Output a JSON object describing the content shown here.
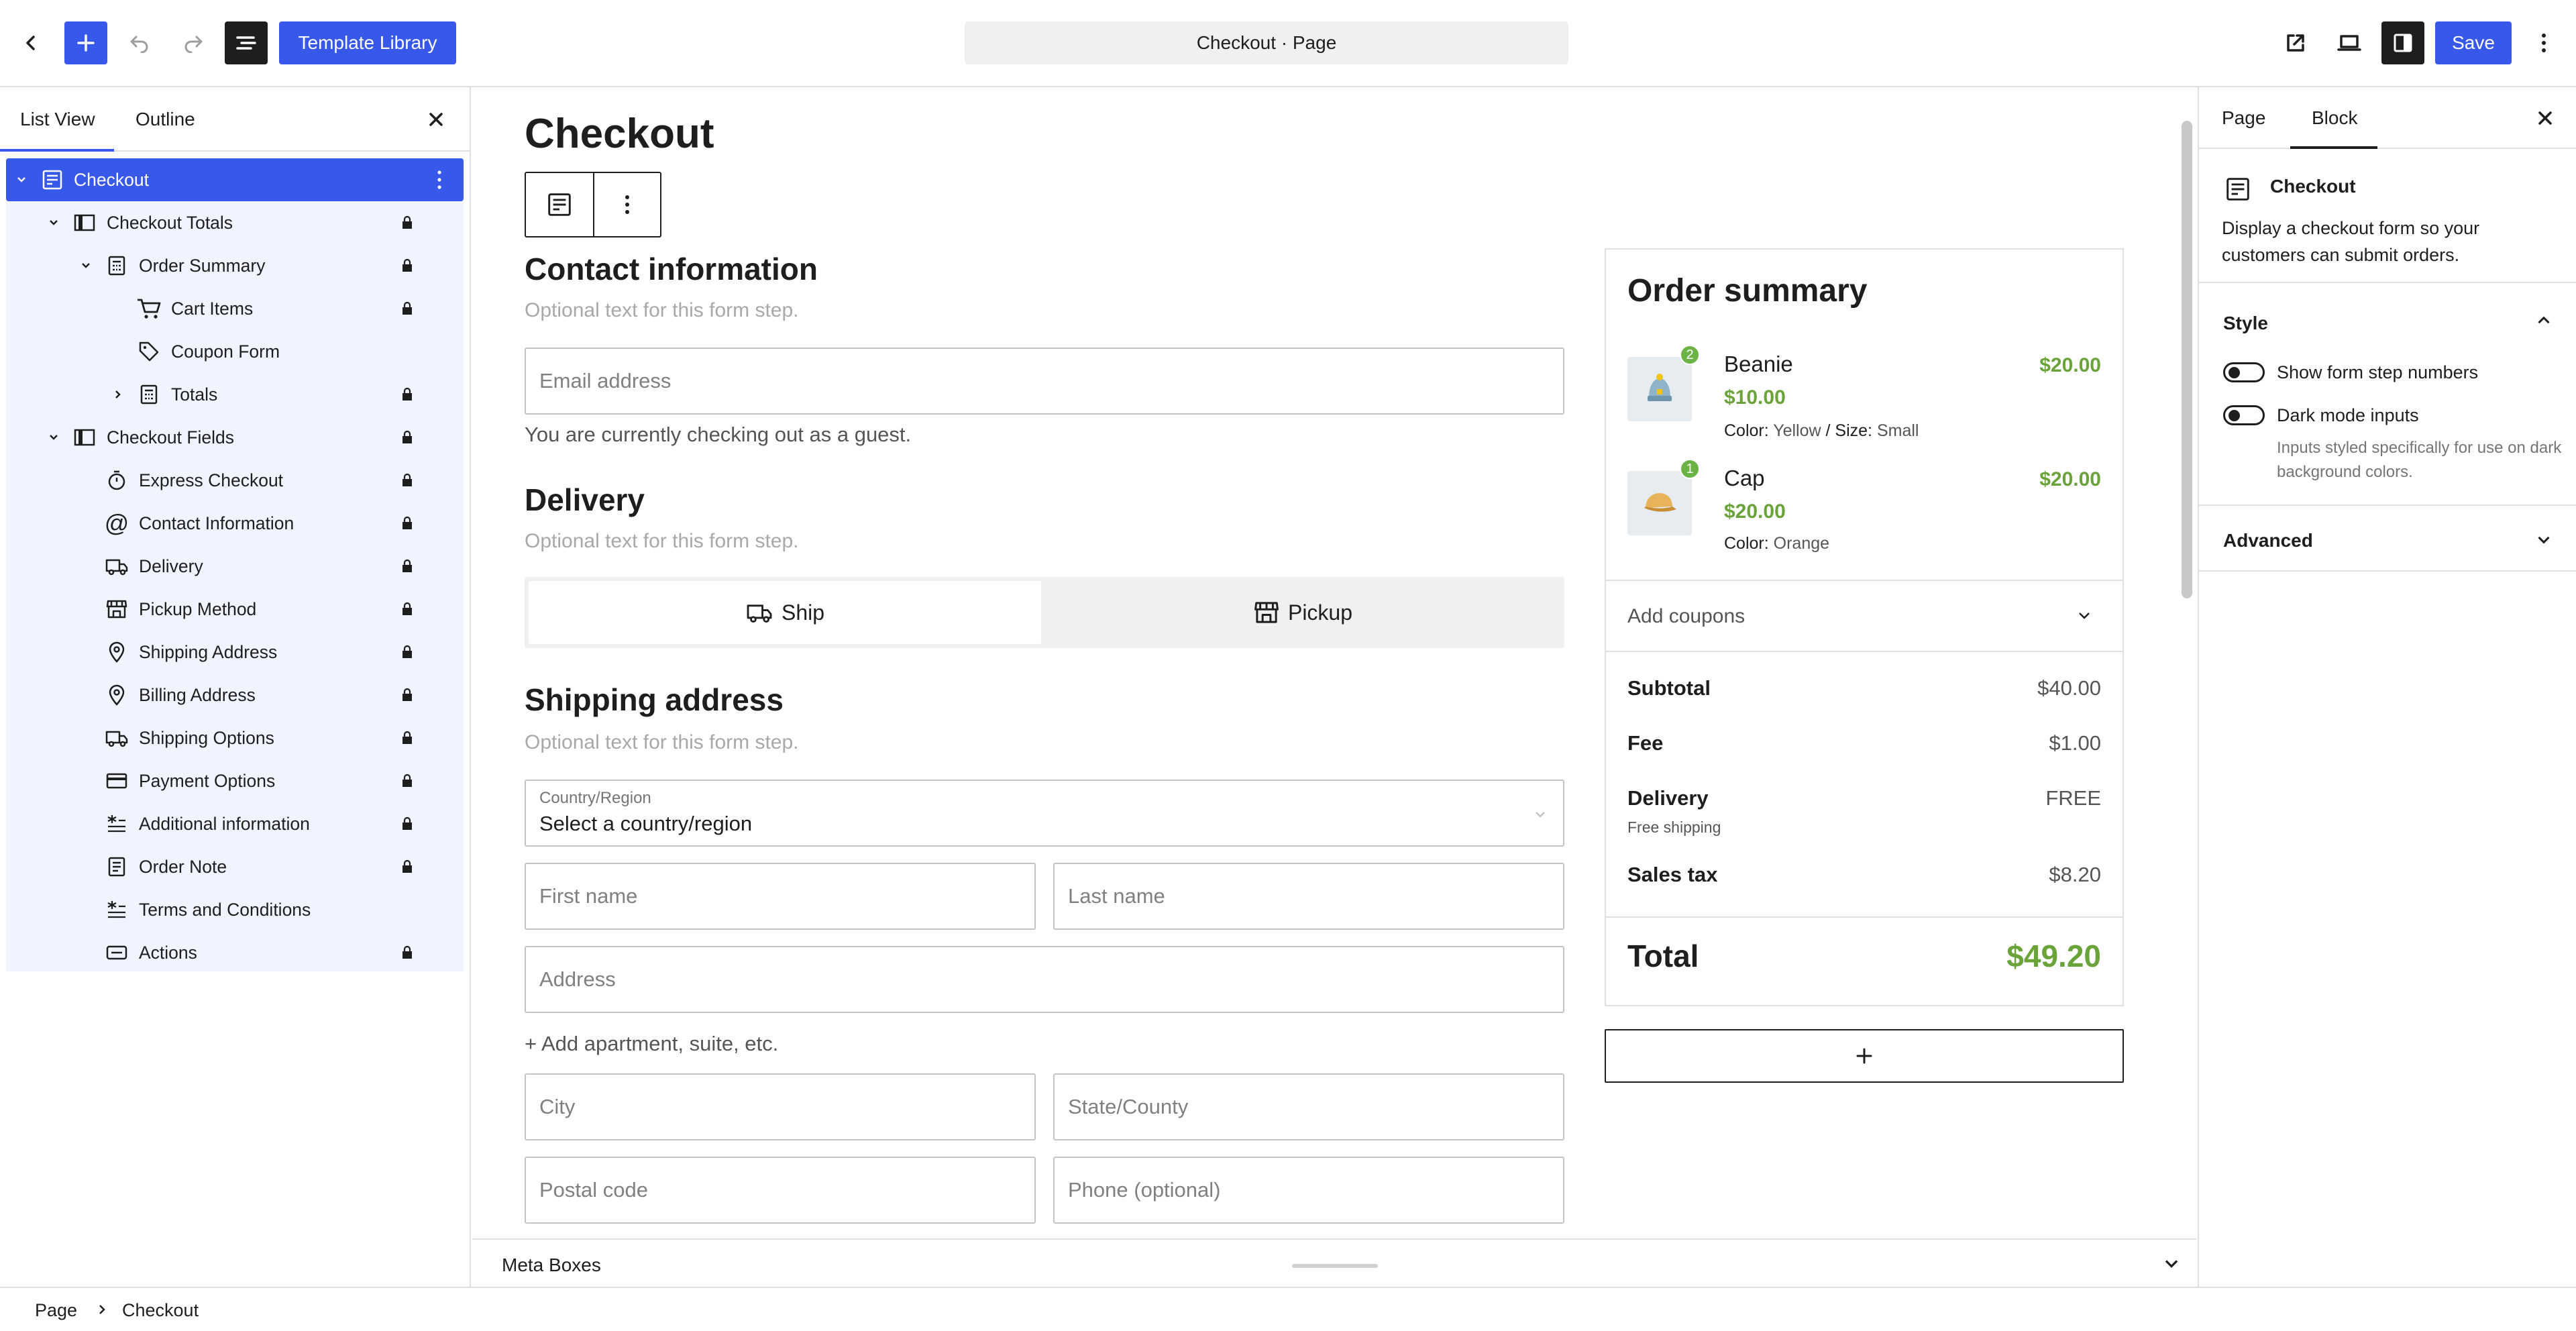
{
  "topbar": {
    "template_library": "Template Library",
    "document_title": "Checkout · Page",
    "save": "Save"
  },
  "left_sidebar": {
    "tabs": [
      "List View",
      "Outline"
    ],
    "tree": [
      {
        "label": "Checkout",
        "icon": "checkout-block-icon",
        "selected": true
      },
      {
        "label": "Checkout Totals",
        "icon": "columns-icon",
        "locked": true
      },
      {
        "label": "Order Summary",
        "icon": "calculator-icon",
        "locked": true
      },
      {
        "label": "Cart Items",
        "icon": "cart-icon",
        "locked": true
      },
      {
        "label": "Coupon Form",
        "icon": "tag-icon",
        "locked": false
      },
      {
        "label": "Totals",
        "icon": "calculator-icon",
        "locked": true
      },
      {
        "label": "Checkout Fields",
        "icon": "columns-icon",
        "locked": true
      },
      {
        "label": "Express Checkout",
        "icon": "stopwatch-icon",
        "locked": true
      },
      {
        "label": "Contact Information",
        "icon": "at-symbol-icon",
        "locked": true
      },
      {
        "label": "Delivery",
        "icon": "truck-icon",
        "locked": true
      },
      {
        "label": "Pickup Method",
        "icon": "store-icon",
        "locked": true
      },
      {
        "label": "Shipping Address",
        "icon": "map-pin-icon",
        "locked": true
      },
      {
        "label": "Billing Address",
        "icon": "map-pin-icon",
        "locked": true
      },
      {
        "label": "Shipping Options",
        "icon": "truck-icon",
        "locked": true
      },
      {
        "label": "Payment Options",
        "icon": "credit-card-icon",
        "locked": true
      },
      {
        "label": "Additional information",
        "icon": "asterisk-lines-icon",
        "locked": true
      },
      {
        "label": "Order Note",
        "icon": "note-icon",
        "locked": true
      },
      {
        "label": "Terms and Conditions",
        "icon": "asterisk-lines-icon",
        "locked": false
      },
      {
        "label": "Actions",
        "icon": "button-icon",
        "locked": true
      }
    ]
  },
  "canvas": {
    "page_title": "Checkout",
    "contact": {
      "heading": "Contact information",
      "hint": "Optional text for this form step.",
      "email_placeholder": "Email address",
      "guest_note": "You are currently checking out as a guest."
    },
    "delivery": {
      "heading": "Delivery",
      "hint": "Optional text for this form step.",
      "ship": "Ship",
      "pickup": "Pickup"
    },
    "shipping": {
      "heading": "Shipping address",
      "hint": "Optional text for this form step.",
      "country_label": "Country/Region",
      "country_value": "Select a country/region",
      "first_name": "First name",
      "last_name": "Last name",
      "address": "Address",
      "add_apartment": "+ Add apartment, suite, etc.",
      "city": "City",
      "state": "State/County",
      "postal": "Postal code",
      "phone": "Phone (optional)"
    },
    "order_summary": {
      "title": "Order summary",
      "items": [
        {
          "name": "Beanie",
          "qty": "2",
          "price": "$10.00",
          "total": "$20.00",
          "meta_label1": "Color:",
          "meta_value1": "Yellow",
          "meta_sep": "/",
          "meta_label2": "Size:",
          "meta_value2": "Small"
        },
        {
          "name": "Cap",
          "qty": "1",
          "price": "$20.00",
          "total": "$20.00",
          "meta_label1": "Color:",
          "meta_value1": "Orange"
        }
      ],
      "add_coupons": "Add coupons",
      "subtotal_label": "Subtotal",
      "subtotal": "$40.00",
      "fee_label": "Fee",
      "fee": "$1.00",
      "delivery_label": "Delivery",
      "delivery": "FREE",
      "delivery_note": "Free shipping",
      "tax_label": "Sales tax",
      "tax": "$8.20",
      "total_label": "Total",
      "total": "$49.20"
    },
    "meta_boxes": "Meta Boxes"
  },
  "right_sidebar": {
    "tabs": [
      "Page",
      "Block"
    ],
    "block_name": "Checkout",
    "block_description": "Display a checkout form so your customers can submit orders.",
    "style_heading": "Style",
    "toggle1": "Show form step numbers",
    "toggle2": "Dark mode inputs",
    "toggle2_help": "Inputs styled specifically for use on dark background colors.",
    "advanced": "Advanced"
  },
  "footer": {
    "breadcrumb": [
      "Page",
      "Checkout"
    ]
  },
  "colors": {
    "accent": "#3858e9",
    "price_green": "#6aa33a",
    "tree_bg": "#f0f4ff"
  }
}
